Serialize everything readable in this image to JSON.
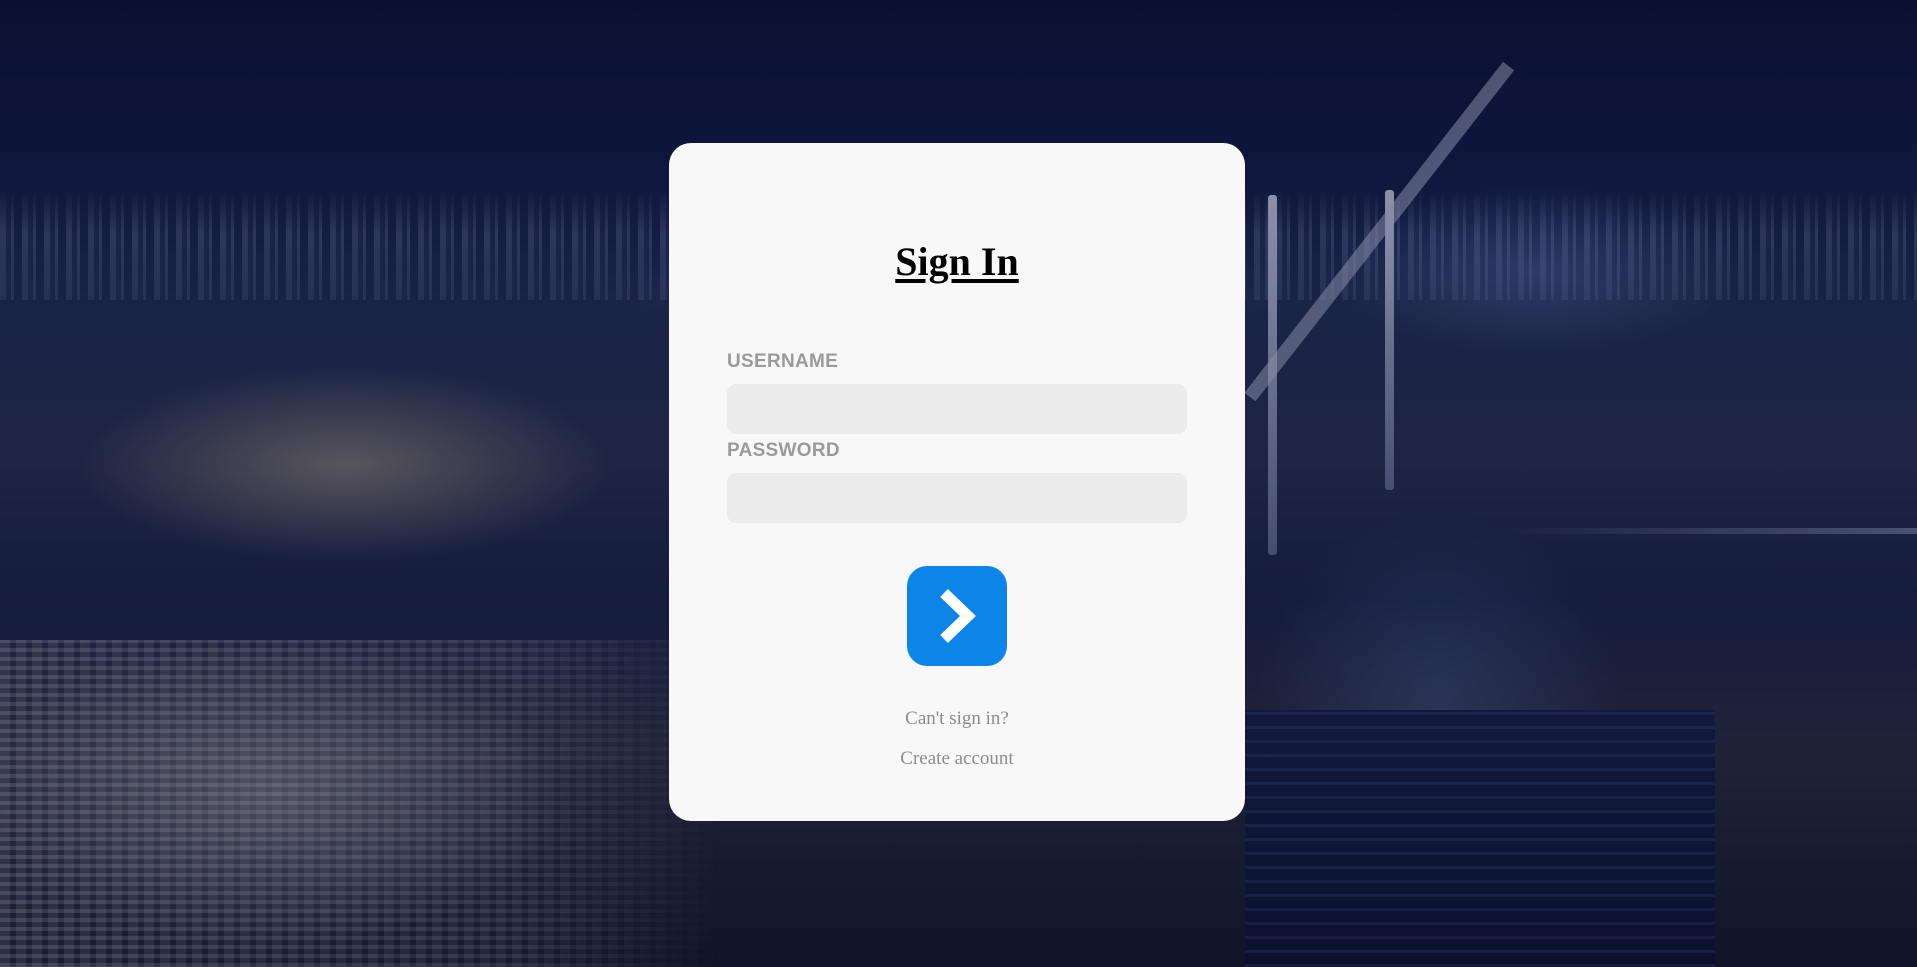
{
  "form": {
    "title": "Sign In",
    "username_label": "USERNAME",
    "username_value": "",
    "password_label": "PASSWORD",
    "password_value": "",
    "submit_icon": "chevron-right-icon",
    "cant_sign_in_link": "Can't sign in?",
    "create_account_link": "Create account"
  },
  "colors": {
    "card_background": "#f8f8f8",
    "input_background": "#ececec",
    "label_color": "#9a9a9a",
    "link_color": "#8c8c8c",
    "submit_button": "#0b85e8",
    "background_night": "#141c4b"
  }
}
